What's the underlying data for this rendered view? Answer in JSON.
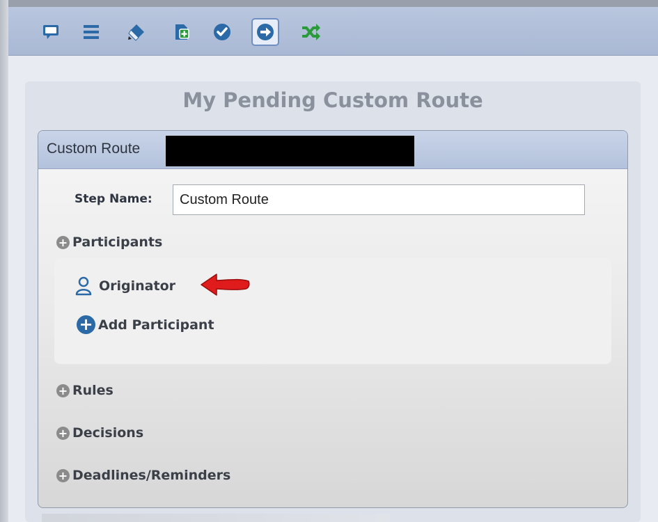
{
  "toolbar": {
    "buttons": [
      {
        "icon": "comment-icon",
        "active": false
      },
      {
        "icon": "list-icon",
        "active": false
      },
      {
        "icon": "eraser-icon",
        "active": false
      },
      {
        "icon": "add-document-icon",
        "active": false
      },
      {
        "icon": "check-circle-icon",
        "active": false
      },
      {
        "icon": "arrow-circle-right-icon",
        "active": true
      },
      {
        "icon": "shuffle-icon",
        "active": false
      }
    ],
    "colors": {
      "primary": "#2b6aa6",
      "accent_green": "#2a9a3a"
    }
  },
  "page": {
    "title": "My Pending Custom Route"
  },
  "panel": {
    "header_label": "Custom Route",
    "step_name_label": "Step Name:",
    "step_name_value": "Custom Route"
  },
  "sections": {
    "participants": "Participants",
    "rules": "Rules",
    "decisions": "Decisions",
    "deadlines": "Deadlines/Reminders"
  },
  "participants": {
    "items": [
      "Originator"
    ],
    "add_label": "Add Participant"
  }
}
